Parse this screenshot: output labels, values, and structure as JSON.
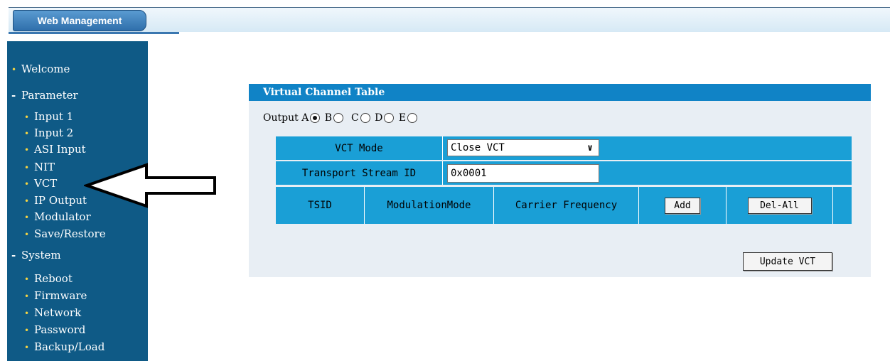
{
  "header": {
    "tab_title": "Web Management"
  },
  "sidebar": {
    "welcome": "Welcome",
    "parameter": "Parameter",
    "parameter_items": [
      "Input 1",
      "Input 2",
      "ASI Input",
      "NIT",
      "VCT",
      "IP Output",
      "Modulator",
      "Save/Restore"
    ],
    "system": "System",
    "system_items": [
      "Reboot",
      "Firmware",
      "Network",
      "Password",
      "Backup/Load"
    ]
  },
  "panel": {
    "title": "Virtual Channel Table",
    "output_label": "Output",
    "outputs": [
      "A",
      "B",
      "C",
      "D",
      "E"
    ],
    "selected_output": "A",
    "vct_mode_label": "VCT Mode",
    "vct_mode_value": "Close VCT",
    "ts_id_label": "Transport Stream ID",
    "ts_id_value": "0x0001",
    "columns": [
      "TSID",
      "ModulationMode",
      "Carrier Frequency"
    ],
    "add_label": "Add",
    "del_all_label": "Del-All",
    "update_label": "Update VCT"
  },
  "colors": {
    "sidebar_bg": "#0f5a86",
    "header_bg": "#1083c6",
    "grid_bg": "#1a9fd6",
    "panel_bg": "#e8eef4"
  }
}
